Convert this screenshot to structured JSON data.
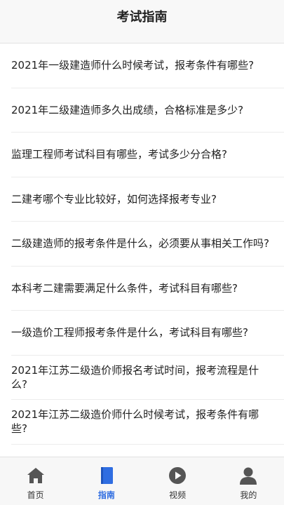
{
  "header": {
    "title": "考试指南"
  },
  "articles": [
    "2021年一级建造师什么时候考试，报考条件有哪些?",
    "2021年二级建造师多久出成绩，合格标准是多少?",
    "监理工程师考试科目有哪些，考试多少分合格?",
    "二建考哪个专业比较好，如何选择报考专业?",
    "二级建造师的报考条件是什么，必须要从事相关工作吗?",
    "本科考二建需要满足什么条件，考试科目有哪些?",
    "一级造价工程师报考条件是什么，考试科目有哪些?",
    "2021年江苏二级造价师报名考试时间，报考流程是什么?",
    "2021年江苏二级造价师什么时候考试，报考条件有哪些?"
  ],
  "tabs": [
    {
      "label": "首页",
      "icon": "home-icon"
    },
    {
      "label": "指南",
      "icon": "book-icon",
      "active": true
    },
    {
      "label": "视频",
      "icon": "play-circle-icon"
    },
    {
      "label": "我的",
      "icon": "user-icon"
    }
  ],
  "colors": {
    "accent": "#2f6de1",
    "icon_gray": "#555555"
  }
}
